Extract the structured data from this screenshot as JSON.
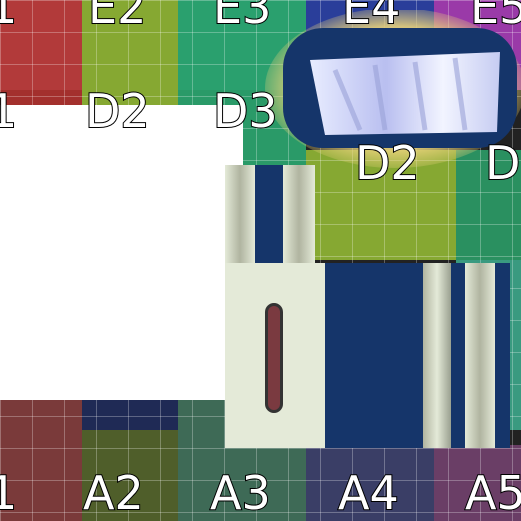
{
  "atlas": {
    "rows": [
      {
        "row": "1",
        "cells": [
          {
            "label": "1",
            "color": "#b23a3a"
          },
          {
            "label": "E2",
            "color": "#86a832"
          },
          {
            "label": "E3",
            "color": "#2aa06e"
          },
          {
            "label": "E4",
            "color": "#2a3e9a"
          },
          {
            "label": "E5",
            "color": "#9a3aa8"
          }
        ]
      },
      {
        "row": "2",
        "cells": [
          {
            "label": "1",
            "color": "#a3302d"
          },
          {
            "label": "D2",
            "color": "#86a832"
          },
          {
            "label": "D3",
            "color": "#2a9a68"
          },
          {
            "label": "D2",
            "color": "#86a832"
          },
          {
            "label": "D",
            "color": "#2a9060"
          }
        ]
      },
      {
        "row": "3",
        "cells": [
          {
            "label": "",
            "color": "#9a2a2a"
          },
          {
            "label": "",
            "color": "#6a8a30"
          },
          {
            "label": "",
            "color": "#2a8a60"
          },
          {
            "label": "",
            "color": "#2a3e80"
          },
          {
            "label": "",
            "color": "#3a9a80"
          }
        ]
      },
      {
        "row": "4",
        "cells": [
          {
            "label": "1",
            "color": "#7a3a3a"
          },
          {
            "label": "A2",
            "color": "#4f5e2a"
          },
          {
            "label": "A3",
            "color": "#3e6a56"
          },
          {
            "label": "A4",
            "color": "#3a3e66"
          },
          {
            "label": "A5",
            "color": "#6a3e66"
          }
        ]
      }
    ],
    "overlays": {
      "blank_color": "#ffffff",
      "navy": "#15356a",
      "cream": "#e4ead8",
      "maroon": "#7a3a40",
      "glow": "#e8d27a"
    }
  }
}
